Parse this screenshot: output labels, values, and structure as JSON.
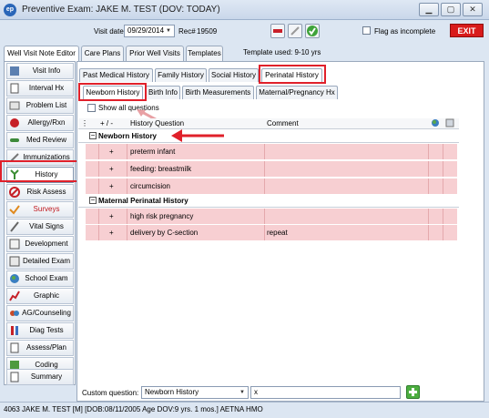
{
  "window": {
    "logo": "ep",
    "title": "Preventive Exam: JAKE M. TEST (DOV: TODAY)"
  },
  "toolbar": {
    "visit_date_label": "Visit date:",
    "visit_date": "09/29/2014",
    "rec_label": "Rec#",
    "rec_number": "19509",
    "flag_label": "Flag as incomplete",
    "exit_label": "EXIT"
  },
  "main_tabs": [
    "Well Visit Note Editor",
    "Care Plans",
    "Prior Well Visits",
    "Templates"
  ],
  "template_used": "Template used:  9-10 yrs",
  "sidebar": {
    "items": [
      "Visit Info",
      "Interval Hx",
      "Problem List",
      "Allergy/Rxn",
      "Med Review",
      "Immunizations",
      "History",
      "Risk Assess",
      "Surveys",
      "Vital Signs",
      "Development",
      "Detailed Exam",
      "School Exam",
      "Graphic",
      "AG/Counseling",
      "Diag Tests",
      "Assess/Plan",
      "Coding",
      "Summary"
    ]
  },
  "history_tabs": [
    "Past Medical History",
    "Family History",
    "Social History",
    "Perinatal History"
  ],
  "perinatal_tabs": [
    "Newborn History",
    "Birth Info",
    "Birth Measurements",
    "Maternal/Pregnancy Hx"
  ],
  "show_all_label": "Show all questions",
  "grid": {
    "headers": {
      "plusminus": "+ / -",
      "question": "History Question",
      "comment": "Comment"
    },
    "sections": [
      {
        "title": "Newborn History",
        "collapse": "−",
        "rows": [
          {
            "sign": "+",
            "question": "preterm infant",
            "comment": ""
          },
          {
            "sign": "+",
            "question": "feeding: breastmilk",
            "comment": ""
          },
          {
            "sign": "+",
            "question": "circumcision",
            "comment": ""
          }
        ]
      },
      {
        "title": "Maternal Perinatal History",
        "collapse": "−",
        "rows": [
          {
            "sign": "+",
            "question": "high risk pregnancy",
            "comment": ""
          },
          {
            "sign": "+",
            "question": "delivery by C-section",
            "comment": "repeat"
          }
        ]
      }
    ]
  },
  "custom_question": {
    "label": "Custom question:",
    "value": "Newborn History",
    "clear": "x"
  },
  "status_bar": "4063 JAKE M. TEST [M] [DOB:08/11/2005  Age DOV:9 yrs. 1 mos.] AETNA HMO",
  "colors": {
    "highlight": "#e0202a",
    "row_fill": "#f7cfd2",
    "exit": "#d81b1b"
  }
}
